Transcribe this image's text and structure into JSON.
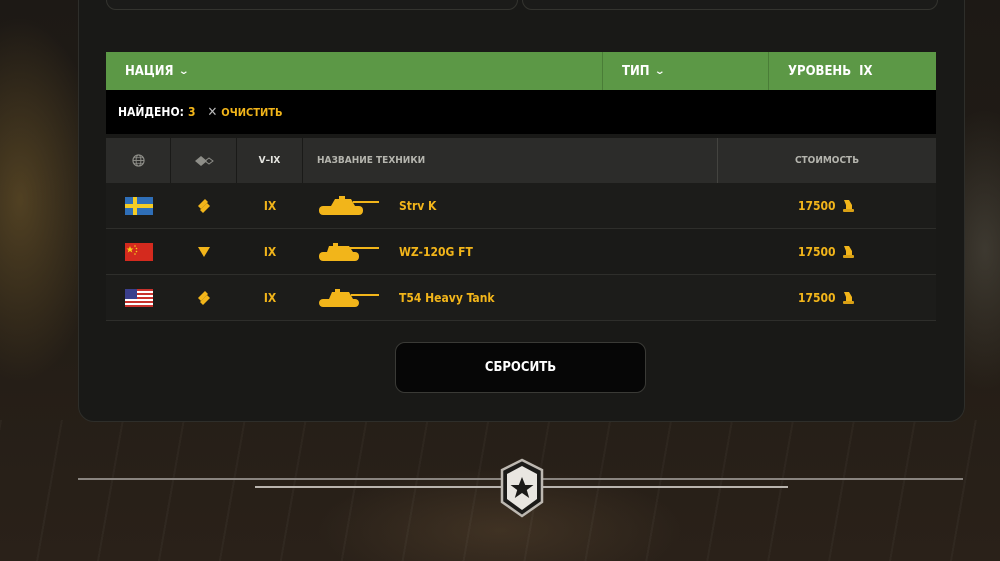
{
  "filters": {
    "nation_label": "НАЦИЯ",
    "type_label": "ТИП",
    "level_label": "УРОВЕНЬ",
    "level_value": "IX"
  },
  "results": {
    "found_label": "НАЙДЕНО:",
    "found_count": "3",
    "clear_label": "ОЧИСТИТЬ"
  },
  "table": {
    "tier_header": "V–IX",
    "name_header": "НАЗВАНИЕ ТЕХНИКИ",
    "cost_header": "СТОИМОСТЬ",
    "rows": [
      {
        "nation": "sweden",
        "type_icon": "heavy-tank-icon",
        "tier": "IX",
        "name": "Strv K",
        "cost": "17500"
      },
      {
        "nation": "china",
        "type_icon": "tank-destroyer-icon",
        "tier": "IX",
        "name": "WZ-120G FT",
        "cost": "17500"
      },
      {
        "nation": "usa",
        "type_icon": "heavy-tank-icon",
        "tier": "IX",
        "name": "T54 Heavy Tank",
        "cost": "17500"
      }
    ]
  },
  "reset_label": "СБРОСИТЬ",
  "colors": {
    "accent": "#f2b51a",
    "filter_green": "#5c9846"
  }
}
